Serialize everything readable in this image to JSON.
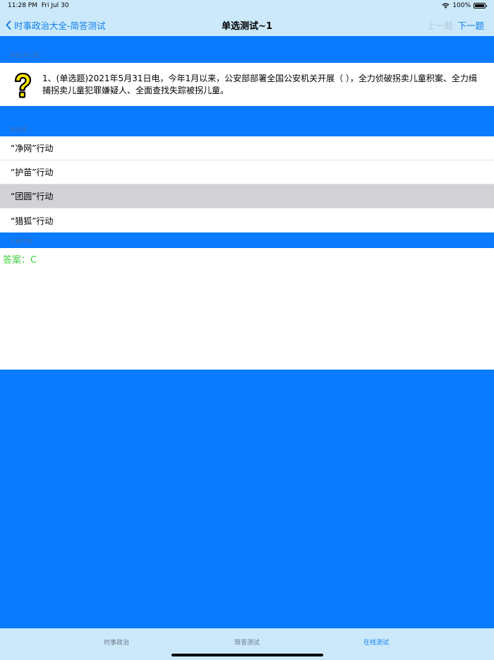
{
  "status": {
    "time": "11:28 PM",
    "date": "Fri Jul 30",
    "battery": "100%"
  },
  "nav": {
    "back_label": "时事政治大全-简答测试",
    "title": "单选测试~1",
    "prev_label": "上一题",
    "next_label": "下一题"
  },
  "question": {
    "section_header": "单选(共1题)",
    "text": "1、(单选题)2021年5月31日电，今年1月以来，公安部部署全国公安机关开展（ ），全力侦破拐卖儿童积案、全力缉捕拐卖儿童犯罪嫌疑人、全面查找失踪被拐儿童。"
  },
  "options": {
    "section_header": "请选择",
    "items": [
      {
        "label": "“净网”行动",
        "selected": false
      },
      {
        "label": "“护苗”行动",
        "selected": false
      },
      {
        "label": "“团圆”行动",
        "selected": true
      },
      {
        "label": "“猎狐”行动",
        "selected": false
      }
    ]
  },
  "answer": {
    "section_header": "正确答案",
    "text": "答案：C"
  },
  "tabs": [
    {
      "label": "时事政治",
      "active": false
    },
    {
      "label": "简答测试",
      "active": false
    },
    {
      "label": "在线测试",
      "active": true
    }
  ],
  "colors": {
    "background": "#0a7aff",
    "bar": "#cce9fb",
    "accent": "#1180ea",
    "answer": "#3fd23f",
    "selected_row": "#d2d1d6"
  }
}
